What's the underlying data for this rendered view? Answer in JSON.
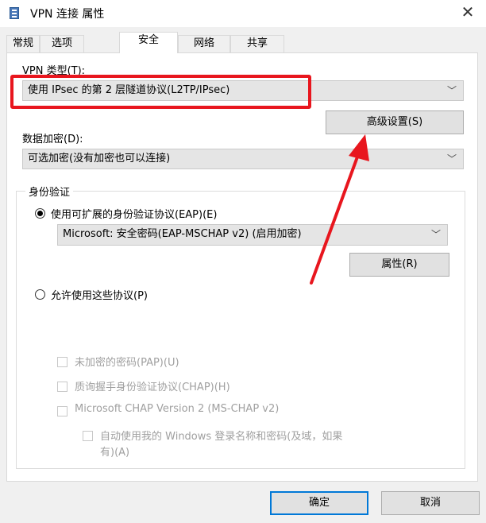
{
  "window": {
    "title": "VPN 连接 属性",
    "close_glyph": "✕"
  },
  "tabs": [
    {
      "label": "常规"
    },
    {
      "label": "选项"
    },
    {
      "label": "安全",
      "active": true
    },
    {
      "label": "网络"
    },
    {
      "label": "共享"
    }
  ],
  "security": {
    "vpn_type_label": "VPN 类型(T):",
    "vpn_type_value": "使用 IPsec 的第 2 层隧道协议(L2TP/IPsec)",
    "advanced_button": "高级设置(S)",
    "encryption_label": "数据加密(D):",
    "encryption_value": "可选加密(没有加密也可以连接)",
    "auth_group_title": "身份验证",
    "eap_radio_label": "使用可扩展的身份验证协议(EAP)(E)",
    "eap_radio_checked": true,
    "eap_method_value": "Microsoft: 安全密码(EAP-MSCHAP v2) (启用加密)",
    "properties_button": "属性(R)",
    "allow_protocols_radio_label": "允许使用这些协议(P)",
    "allow_protocols_checked": false,
    "protocols": [
      {
        "label": "未加密的密码(PAP)(U)",
        "checked": false,
        "enabled": false
      },
      {
        "label": "质询握手身份验证协议(CHAP)(H)",
        "checked": false,
        "enabled": false
      },
      {
        "label": "Microsoft CHAP Version 2 (MS-CHAP v2)",
        "checked": false,
        "enabled": false
      }
    ],
    "auto_windows_login_line1": "自动使用我的 Windows 登录名称和密码(及域，如果",
    "auto_windows_login_line2": "有)(A)"
  },
  "footer": {
    "ok_button": "确定",
    "cancel_button": "取消"
  },
  "chevron_glyph": "﹀",
  "annotation": {
    "color": "#e8161e"
  }
}
